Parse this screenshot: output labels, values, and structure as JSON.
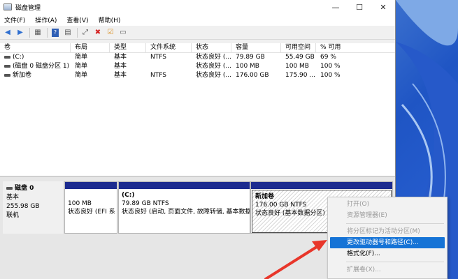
{
  "window": {
    "title": "磁盘管理",
    "minimize_glyph": "—",
    "maximize_glyph": "☐",
    "close_glyph": "✕"
  },
  "menu": [
    "文件(F)",
    "操作(A)",
    "查看(V)",
    "帮助(H)"
  ],
  "toolbar_icons": [
    "back-icon",
    "forward-icon",
    "properties-icon",
    "help-icon",
    "refresh-icon",
    "connect-icon",
    "delete-icon",
    "check-icon",
    "settings-icon"
  ],
  "list": {
    "headers": [
      "卷",
      "布局",
      "类型",
      "文件系统",
      "状态",
      "容量",
      "可用空间",
      "% 可用"
    ],
    "rows": [
      [
        "(C:)",
        "简单",
        "基本",
        "NTFS",
        "状态良好 (...",
        "79.89 GB",
        "55.49 GB",
        "69 %"
      ],
      [
        "(磁盘 0 磁盘分区 1)",
        "简单",
        "基本",
        "",
        "状态良好 (...",
        "100 MB",
        "100 MB",
        "100 %"
      ],
      [
        "新加卷",
        "简单",
        "基本",
        "NTFS",
        "状态良好 (...",
        "176.00 GB",
        "175.90 ...",
        "100 %"
      ]
    ]
  },
  "disk": {
    "name": "磁盘 0",
    "type": "基本",
    "size": "255.98 GB",
    "status": "联机"
  },
  "partitions": [
    {
      "name": "",
      "size": "100 MB",
      "status": "状态良好 (EFI 系"
    },
    {
      "name": "(C:)",
      "size": "79.89 GB NTFS",
      "status": "状态良好 (启动, 页面文件, 故障转储, 基本数据"
    },
    {
      "name": "新加卷",
      "size": "176.00 GB NTFS",
      "status": "状态良好 (基本数据分区)"
    }
  ],
  "context_menu": [
    {
      "label": "打开(O)",
      "state": "disabled"
    },
    {
      "label": "资源管理器(E)",
      "state": "disabled"
    },
    {
      "label": "---"
    },
    {
      "label": "将分区标记为活动分区(M)",
      "state": "disabled"
    },
    {
      "label": "更改驱动器号和路径(C)...",
      "state": "highlight"
    },
    {
      "label": "格式化(F)...",
      "state": "normal"
    },
    {
      "label": "---"
    },
    {
      "label": "扩展卷(X)...",
      "state": "disabled"
    }
  ],
  "colors": {
    "partition_bar": "#1c2b8f",
    "menu_highlight": "#1573d6",
    "arrow": "#e8362a"
  }
}
